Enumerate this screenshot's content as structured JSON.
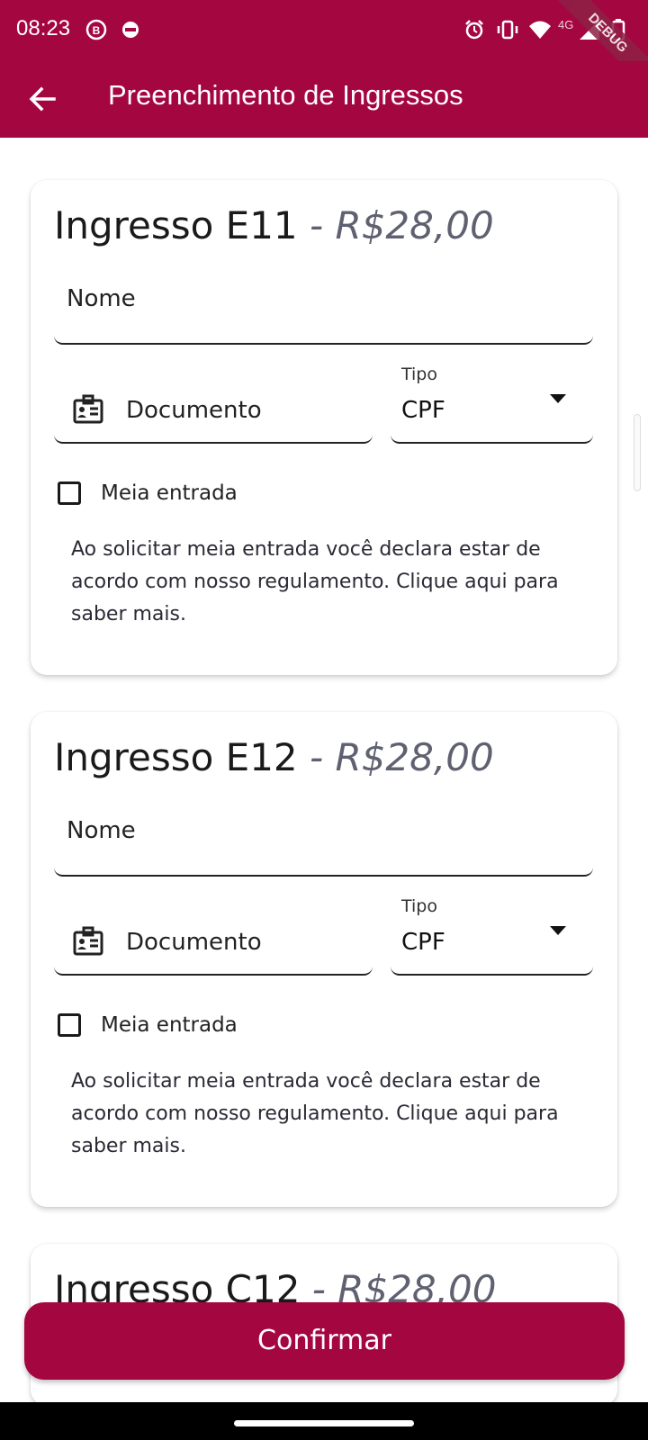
{
  "status_bar": {
    "time": "08:23",
    "network": "4G",
    "debug_badge": "DEBUG"
  },
  "app_bar": {
    "title": "Preenchimento de Ingressos",
    "back_icon": "arrow-left-icon"
  },
  "tickets": [
    {
      "title": "Ingresso E11",
      "price": "- R$28,00",
      "name_label": "Nome",
      "document_label": "Documento",
      "document_icon": "id-card-icon",
      "type_label": "Tipo",
      "type_value": "CPF",
      "half_price_label": "Meia entrada",
      "half_price_checked": false,
      "notice": "Ao solicitar meia entrada você declara estar de acordo com nosso regulamento. Clique aqui para saber mais."
    },
    {
      "title": "Ingresso E12",
      "price": "- R$28,00",
      "name_label": "Nome",
      "document_label": "Documento",
      "document_icon": "id-card-icon",
      "type_label": "Tipo",
      "type_value": "CPF",
      "half_price_label": "Meia entrada",
      "half_price_checked": false,
      "notice": "Ao solicitar meia entrada você declara estar de acordo com nosso regulamento. Clique aqui para saber mais."
    },
    {
      "title": "Ingresso C12",
      "price": "- R$28,00"
    }
  ],
  "confirm_button": {
    "label": "Confirmar"
  },
  "colors": {
    "primary": "#a4063f",
    "price_text": "#5f6170"
  }
}
